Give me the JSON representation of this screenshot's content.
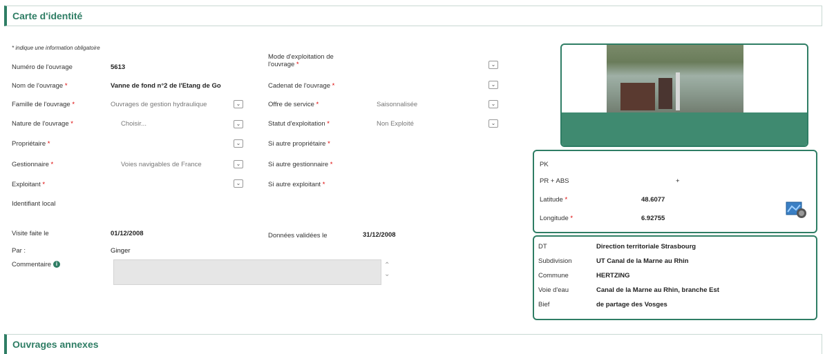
{
  "header": {
    "title": "Carte d'identité"
  },
  "required_note": "* indique une information obligatoire",
  "left": {
    "numero": {
      "label": "Numéro de l'ouvrage",
      "value": "5613"
    },
    "nom": {
      "label": "Nom de l'ouvrage",
      "value": "Vanne de fond n°2 de l'Etang de Go"
    },
    "famille": {
      "label": "Famille de l'ouvrage",
      "value": "Ouvrages de gestion hydraulique"
    },
    "nature": {
      "label": "Nature de l'ouvrage",
      "value": "Choisir..."
    },
    "proprietaire": {
      "label": "Propriétaire",
      "value": ""
    },
    "gestionnaire": {
      "label": "Gestionnaire",
      "value": "Voies navigables de France"
    },
    "exploitant": {
      "label": "Exploitant",
      "value": ""
    },
    "identifiant": {
      "label": "Identifiant local",
      "value": ""
    }
  },
  "middle": {
    "mode": {
      "label": "Mode d'exploitation de l'ouvrage",
      "value": ""
    },
    "cadenat": {
      "label": "Cadenat de l'ouvrage",
      "value": ""
    },
    "offre": {
      "label": "Offre de service",
      "value": "Saisonnalisée"
    },
    "statut": {
      "label": "Statut d'exploitation",
      "value": "Non Exploité"
    },
    "si_prop": {
      "label": "Si autre propriétaire",
      "value": ""
    },
    "si_gest": {
      "label": "Si autre gestionnaire",
      "value": ""
    },
    "si_expl": {
      "label": "Si autre exploitant",
      "value": ""
    }
  },
  "visit": {
    "visite_label": "Visite faite le",
    "visite_value": "01/12/2008",
    "par_label": "Par :",
    "par_value": "Ginger",
    "donnees_label": "Données validées le",
    "donnees_value": "31/12/2008",
    "comment_label": "Commentaire"
  },
  "location": {
    "pk": {
      "label": "PK",
      "value": ""
    },
    "pr": {
      "label": "PR + ABS",
      "value": "+"
    },
    "lat": {
      "label": "Latitude",
      "value": "48.6077"
    },
    "lon": {
      "label": "Longitude",
      "value": "6.92755"
    }
  },
  "territory": {
    "rows": [
      {
        "label": "DT",
        "value": "Direction territoriale Strasbourg"
      },
      {
        "label": "Subdivision",
        "value": "UT Canal de la Marne au Rhin"
      },
      {
        "label": "Commune",
        "value": "HERTZING"
      },
      {
        "label": "Voie d'eau",
        "value": "Canal de la Marne au Rhin, branche Est"
      },
      {
        "label": "Bief",
        "value": "de partage des Vosges"
      }
    ]
  },
  "footer_section": {
    "title": "Ouvrages annexes"
  },
  "icons": {
    "dropdown": "chevron-down-icon",
    "map": "map-location-icon",
    "info": "info-icon"
  },
  "colors": {
    "accent": "#2e7d64",
    "required": "#dd0000"
  }
}
